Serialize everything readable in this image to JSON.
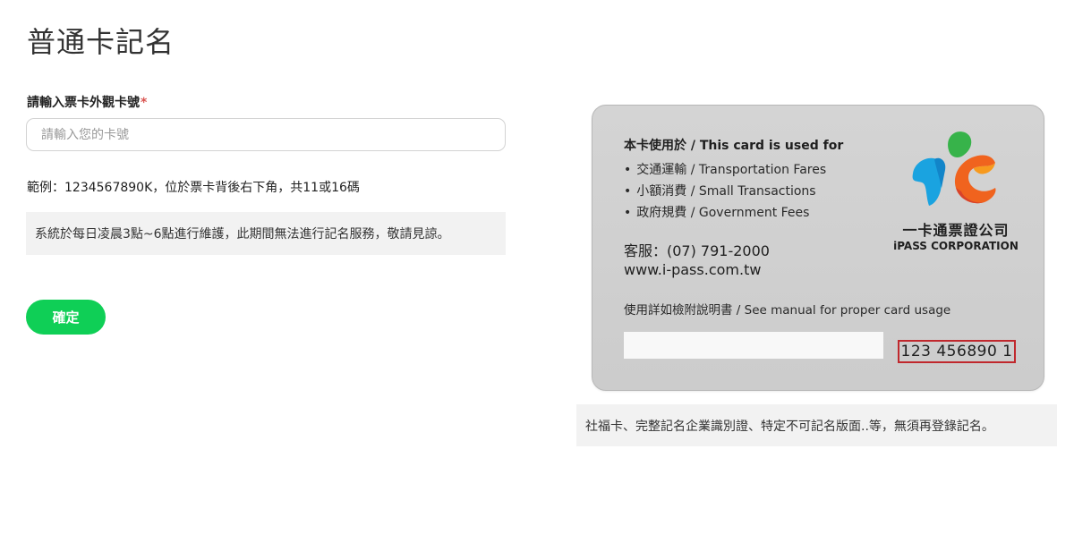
{
  "page": {
    "title": "普通卡記名"
  },
  "form": {
    "label": "請輸入票卡外觀卡號",
    "required_mark": "*",
    "input_placeholder": "請輸入您的卡號",
    "input_value": "",
    "example": "範例：1234567890K，位於票卡背後右下角，共11或16碼",
    "maintenance_notice": "系統於每日凌晨3點~6點進行維護，此期間無法進行記名服務，敬請見諒。",
    "confirm_label": "確定"
  },
  "card": {
    "used_for": "本卡使用於 / This card is used for",
    "uses": [
      "交通運輸 / Transportation Fares",
      "小額消費 / Small Transactions",
      "政府規費 / Government Fees"
    ],
    "bullet": "•",
    "service": "客服：(07) 791-2000",
    "website": "www.i-pass.com.tw",
    "manual": "使用詳如檢附說明書 / See manual for proper card usage",
    "number": "123 456890 1",
    "company_zh": "一卡通票證公司",
    "company_en": "iPASS CORPORATION",
    "logo_icon": "ipass-logo-icon",
    "number_highlight_color": "#c0282d"
  },
  "note": "社福卡、完整記名企業識別證、特定不可記名版面..等，無須再登錄記名。",
  "colors": {
    "confirm_button": "#0fcf56",
    "required": "#d9534f",
    "notice_background": "#f2f2f2"
  }
}
